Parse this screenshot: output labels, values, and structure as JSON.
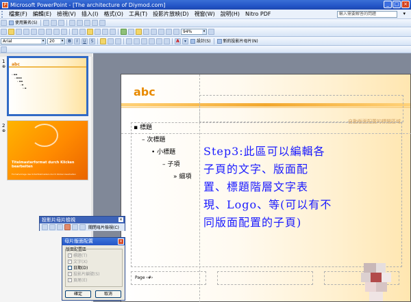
{
  "window": {
    "title": "Microsoft PowerPoint - [The architecture of Diymod.com]",
    "buttons": [
      "_",
      "□",
      "×"
    ]
  },
  "menubar": {
    "items": [
      "檔案(F)",
      "編輯(E)",
      "檢視(V)",
      "插入(I)",
      "格式(O)",
      "工具(T)",
      "投影片放映(D)",
      "視窗(W)",
      "說明(H)",
      "Nitro PDF"
    ],
    "help_placeholder": "輸入需要解答的問題"
  },
  "toolbar1": {
    "label": "使用簽名(S)"
  },
  "toolbar2": {
    "zoom": "94%"
  },
  "toolbar3": {
    "font": "Arial",
    "size": "20",
    "bold": "B",
    "italic": "I",
    "underline": "U",
    "shadow": "S",
    "design_label": "設計(S)",
    "new_slide_label": "新的投影片母片(N)"
  },
  "slide_pane": {
    "slides": [
      {
        "number": "1",
        "abc": "abc"
      },
      {
        "number": "2",
        "title": "Titelmasterformat durch Klicken bearbeiten",
        "subtitle": "Formatvorlage des Untertitelmasters durch Klicken bearbeiten"
      }
    ]
  },
  "master_toolbar": {
    "title": "投影片母片檢視",
    "close_label": "關閉母片檢視(C)"
  },
  "layout_dialog": {
    "title": "母片版面配置",
    "group_label": "版面配置區",
    "items": [
      {
        "label": "標題(T)",
        "checked": true,
        "enabled": false
      },
      {
        "label": "文字(X)",
        "checked": true,
        "enabled": false
      },
      {
        "label": "日期(D)",
        "checked": false,
        "enabled": true
      },
      {
        "label": "投影片編號(S)",
        "checked": true,
        "enabled": false
      },
      {
        "label": "頁尾(E)",
        "checked": true,
        "enabled": false
      }
    ],
    "ok": "確定",
    "cancel": "取消"
  },
  "slide": {
    "abc": "abc",
    "header_right": "自動版面配置的標題區域",
    "bullets": [
      "標題",
      "次標題",
      "小標題",
      "子項",
      "細項"
    ],
    "footer": "Page ‹#›",
    "annotation_lines": [
      "Step3:此區可以編輯各",
      "子頁的文字、版面配",
      "置、標題階層文字表",
      "現、Logo、等(可以有不",
      "同版面配置的子頁)"
    ]
  },
  "colors": {
    "accent_orange": "#e88a00",
    "annotation_blue": "#1a1aff",
    "titlebar_blue": "#2456c8"
  }
}
